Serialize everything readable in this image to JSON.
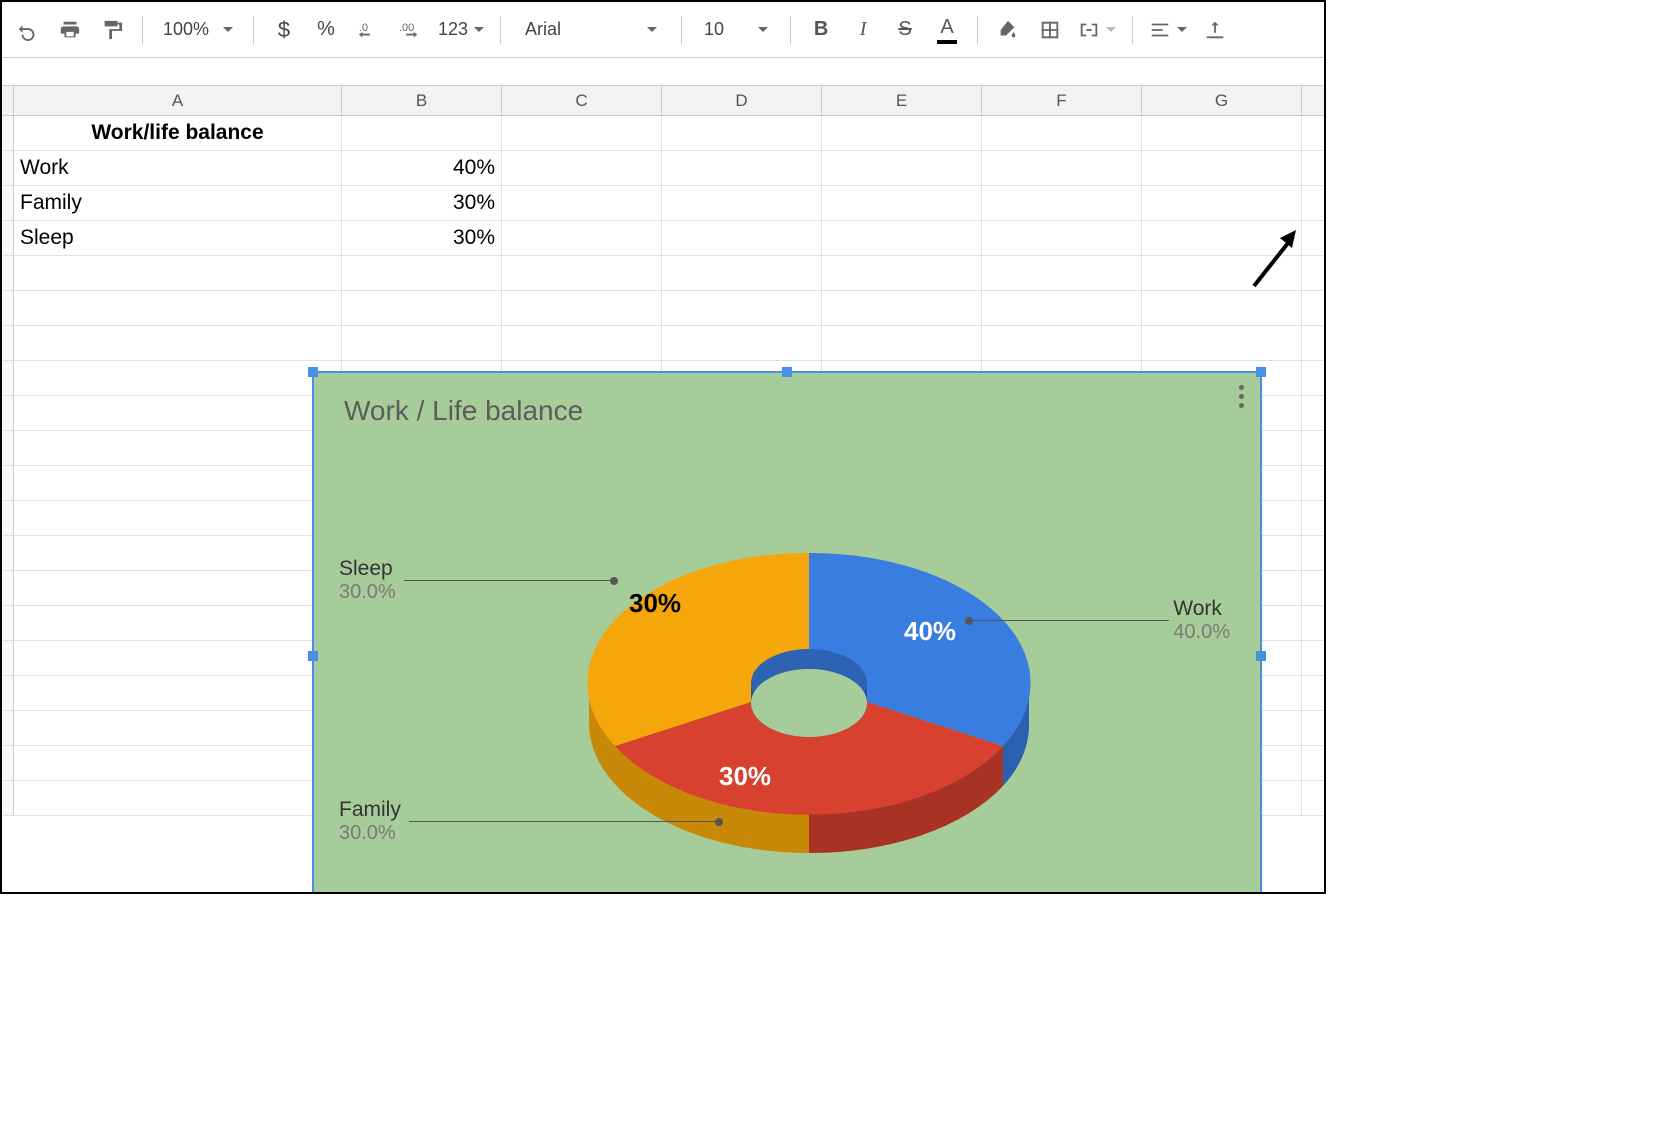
{
  "toolbar": {
    "zoom": "100%",
    "font_family": "Arial",
    "font_size": "10",
    "number_format_label": "123"
  },
  "grid": {
    "columns": [
      "A",
      "B",
      "C",
      "D",
      "E",
      "F",
      "G"
    ],
    "rows": [
      {
        "A": "Work/life balance",
        "B": "",
        "header": true
      },
      {
        "A": "Work",
        "B": "40%"
      },
      {
        "A": "Family",
        "B": "30%"
      },
      {
        "A": "Sleep",
        "B": "30%"
      }
    ]
  },
  "chart": {
    "title": "Work / Life balance",
    "callouts": {
      "work": {
        "label": "Work",
        "sub": "40.0%"
      },
      "family": {
        "label": "Family",
        "sub": "30.0%"
      },
      "sleep": {
        "label": "Sleep",
        "sub": "30.0%"
      }
    },
    "slice_labels": {
      "work": "40%",
      "family": "30%",
      "sleep": "30%"
    },
    "colors": {
      "work": "#3a7de0",
      "family": "#d8412f",
      "sleep": "#f4a60b",
      "bg": "#a6cd99"
    }
  },
  "chart_data": {
    "type": "pie",
    "title": "Work / Life balance",
    "categories": [
      "Work",
      "Family",
      "Sleep"
    ],
    "values": [
      40,
      30,
      30
    ],
    "donut": true,
    "three_d": true
  }
}
